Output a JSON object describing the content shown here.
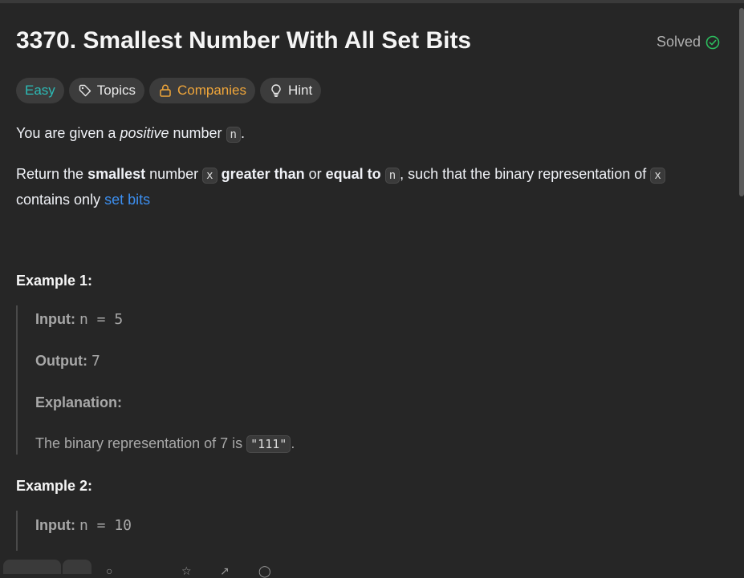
{
  "problem": {
    "title": "3370. Smallest Number With All Set Bits",
    "status": "Solved",
    "tags": {
      "difficulty": "Easy",
      "topics": "Topics",
      "companies": "Companies",
      "hint": "Hint"
    }
  },
  "description": {
    "p1_before": "You are given a ",
    "p1_em": "positive",
    "p1_mid": " number ",
    "p1_code": "n",
    "p1_after": ".",
    "p2_a": "Return the ",
    "p2_b": "smallest",
    "p2_c": " number ",
    "p2_d": "x",
    "p2_e": "greater than",
    "p2_f": " or ",
    "p2_g": "equal to",
    "p2_h": "n",
    "p2_i": ", such that the binary representation of ",
    "p2_j": "x",
    "p2_k": "contains only ",
    "p2_link": "set bits"
  },
  "examples": [
    {
      "title": "Example 1:",
      "input_label": "Input:",
      "input_value": "n = 5",
      "output_label": "Output:",
      "output_value": "7",
      "explanation_label": "Explanation:",
      "explanation_text": "The binary representation of 7 is ",
      "explanation_code": "\"111\"",
      "explanation_end": "."
    },
    {
      "title": "Example 2:",
      "input_label": "Input:",
      "input_value": "n = 10"
    }
  ],
  "colors": {
    "background": "#262626",
    "easy": "#2cbbb6",
    "companies": "#f0a63a",
    "link": "#3c8ff0",
    "solved_check": "#2cbb5d"
  }
}
